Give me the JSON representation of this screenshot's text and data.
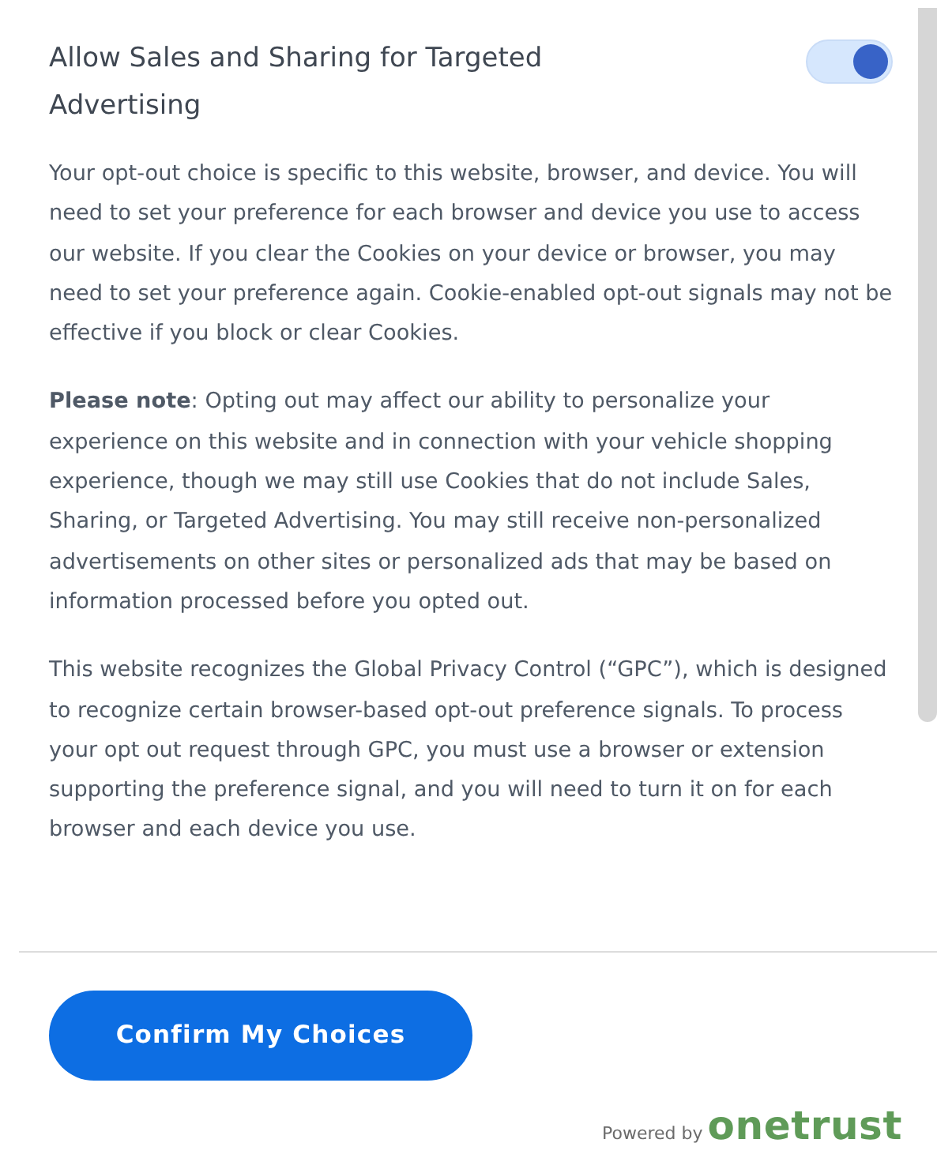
{
  "preference": {
    "title": "Allow Sales and Sharing for Targeted Advertising",
    "on": true
  },
  "paragraphs": [
    "Your opt-out choice is specific to this website, browser, and device. You will need to set your preference for each browser and device you use to access our website. If you clear the Cookies on your device or browser, you may need to set your preference again. Cookie-enabled opt-out signals may not be effective if you block or clear Cookies.",
    "**Please note**: Opting out may affect our ability to personalize your experience on this website and in connection with your vehicle shopping experience, though we may still use Cookies that do not include Sales, Sharing, or Targeted Advertising. You may still receive non-personalized advertisements on other sites or personalized ads that may be based on information processed before you opted out.",
    "This website recognizes the Global Privacy Control (“GPC”), which is designed to recognize certain browser-based opt-out preference signals. To process your opt out request through GPC, you must use a browser or extension supporting the preference signal, and you will need to turn it on for each browser and each device you use."
  ],
  "confirm_button": "Confirm My Choices",
  "footer": {
    "powered_by": "Powered by",
    "brand": "onetrust"
  }
}
